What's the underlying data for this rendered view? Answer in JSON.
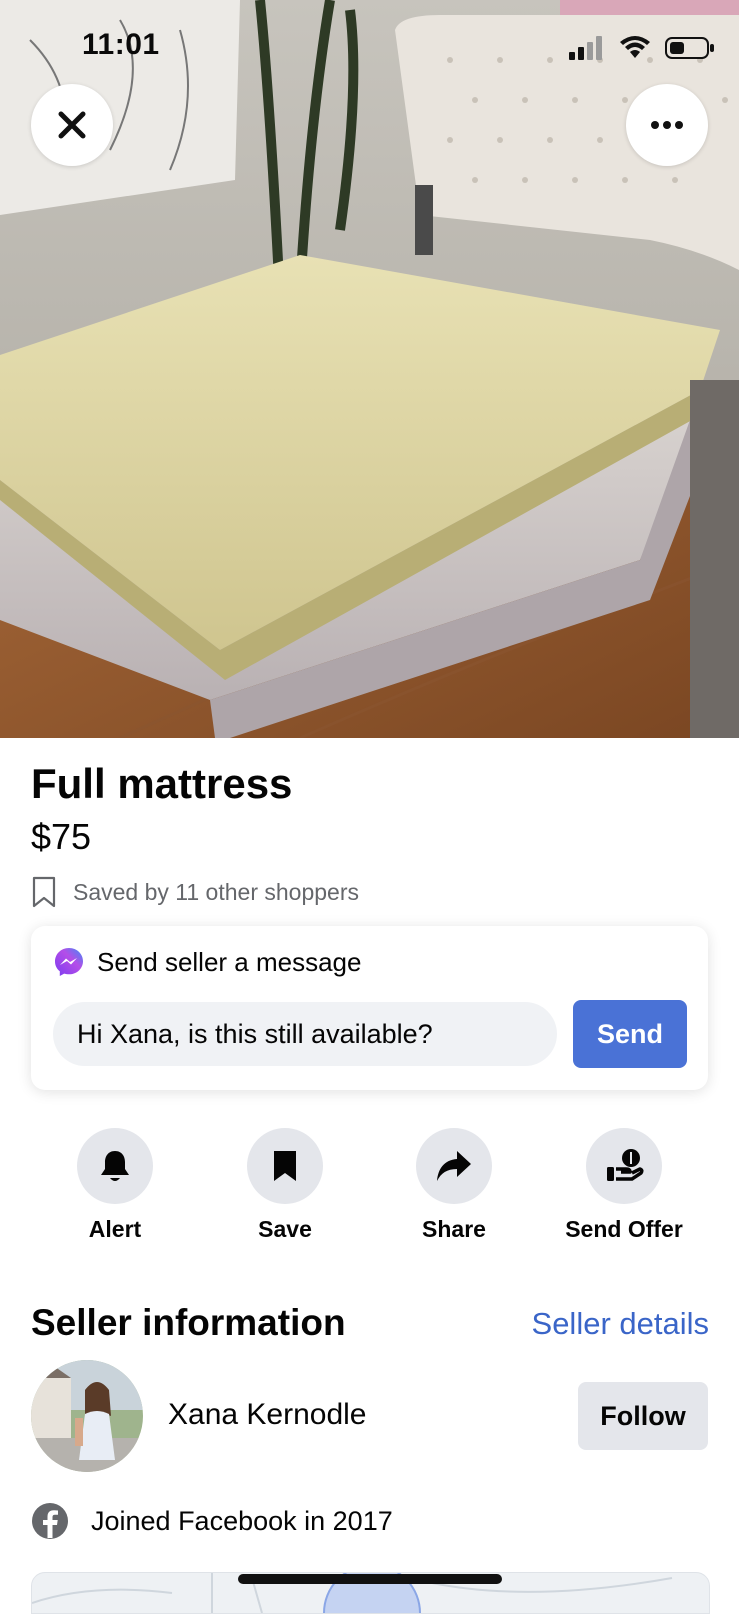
{
  "status_bar": {
    "time": "11:01"
  },
  "photo": {
    "icon": "mattress-photo"
  },
  "listing": {
    "title": "Full mattress",
    "price": "$75",
    "saved_text": "Saved by 11 other shoppers"
  },
  "message": {
    "title": "Send seller a message",
    "input_value": "Hi Xana, is this still available?",
    "send_label": "Send"
  },
  "actions": [
    {
      "label": "Alert",
      "icon": "bell-icon"
    },
    {
      "label": "Save",
      "icon": "bookmark-icon"
    },
    {
      "label": "Share",
      "icon": "share-icon"
    },
    {
      "label": "Send Offer",
      "icon": "send-offer-icon"
    }
  ],
  "seller": {
    "heading": "Seller information",
    "details_link": "Seller details",
    "name": "Xana Kernodle",
    "follow_label": "Follow",
    "joined": "Joined Facebook in 2017"
  },
  "colors": {
    "accent_blue": "#4a72d6",
    "link_blue": "#3a65c8",
    "secondary_text": "#65676b",
    "button_gray": "#e4e6eb"
  }
}
